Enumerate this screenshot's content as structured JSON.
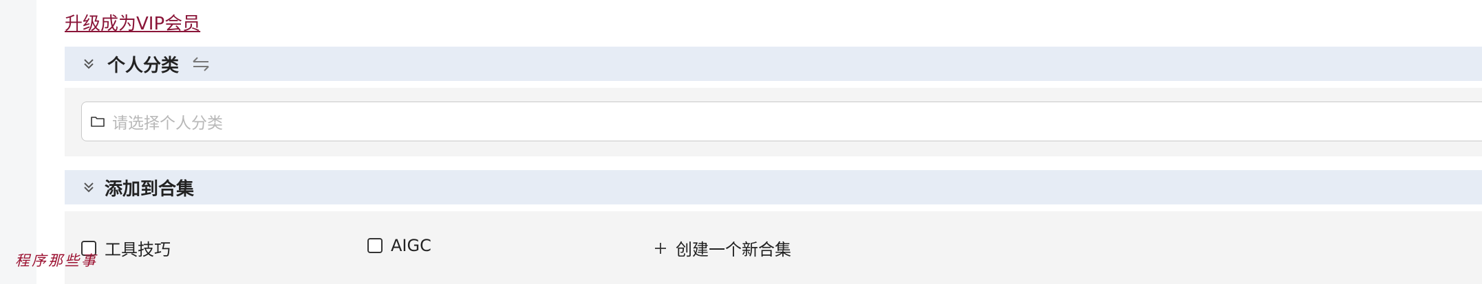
{
  "vip_link": "升级成为VIP会员",
  "personal_category": {
    "title": "个人分类",
    "select_placeholder": "请选择个人分类"
  },
  "collection": {
    "title": "添加到合集",
    "items": [
      {
        "label": "工具技巧",
        "checked": false
      },
      {
        "label": "AIGC",
        "checked": false
      }
    ],
    "create_label": "创建一个新合集"
  },
  "watermark": "程序那些事",
  "colors": {
    "vip_link": "#8a1538",
    "section_header_bg": "#e6ecf5",
    "panel_bg": "#f4f4f4",
    "watermark": "#9b1030"
  }
}
